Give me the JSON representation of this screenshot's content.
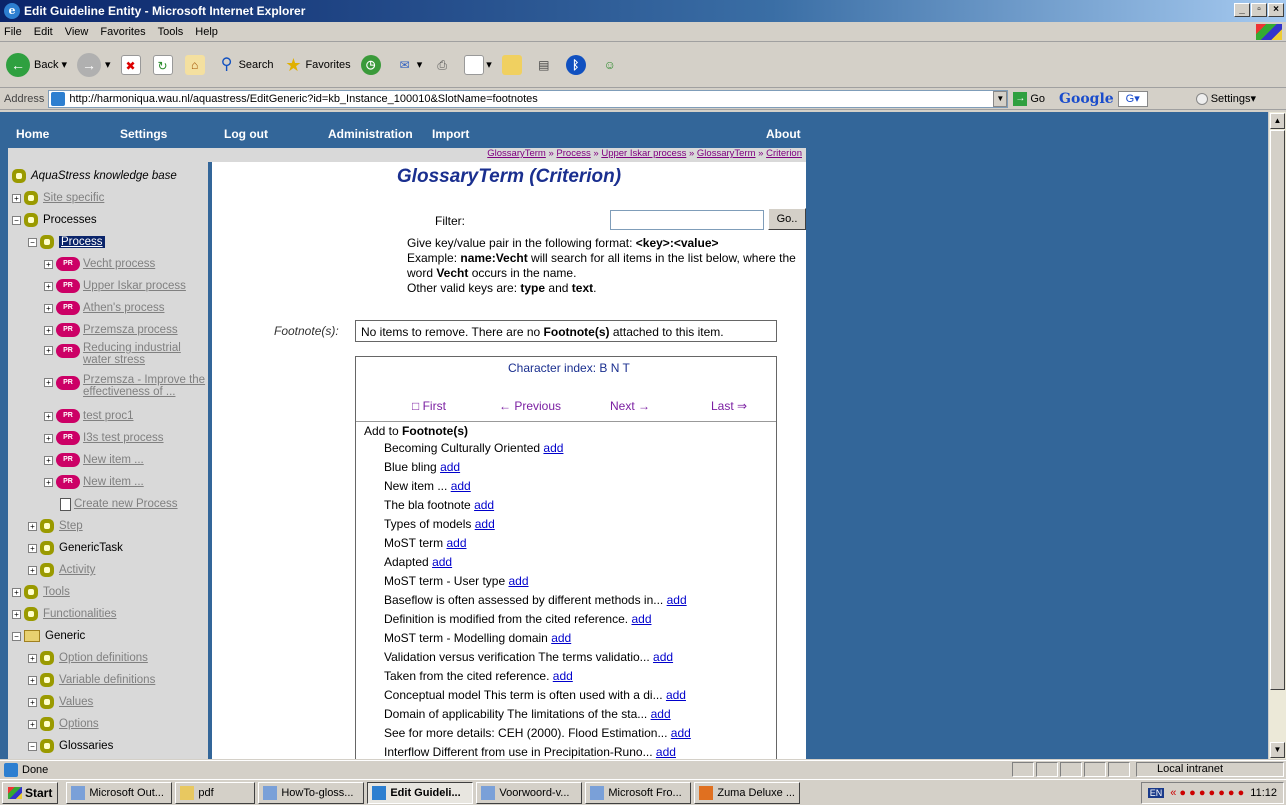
{
  "window": {
    "title": "Edit Guideline Entity - Microsoft Internet Explorer"
  },
  "menu": [
    "File",
    "Edit",
    "View",
    "Favorites",
    "Tools",
    "Help"
  ],
  "toolbar": {
    "back": "Back",
    "search": "Search",
    "favorites": "Favorites"
  },
  "address": {
    "label": "Address",
    "url": "http://harmoniqua.wau.nl/aquastress/EditGeneric?id=kb_Instance_100010&SlotName=footnotes",
    "go": "Go",
    "google": "Google",
    "settings": "Settings"
  },
  "nav": {
    "home": "Home",
    "settings": "Settings",
    "logout": "Log out",
    "administration": "Administration",
    "import": "Import",
    "about": "About"
  },
  "breadcrumb": [
    "GlossaryTerm",
    "Process",
    "Upper Iskar process",
    "GlossaryTerm",
    "Criterion"
  ],
  "breadcrumb_sep": "»",
  "tree": {
    "root": "AquaStress knowledge base",
    "site_specific": "Site specific",
    "processes": "Processes",
    "process": "Process",
    "proc_badge": "PR",
    "process_items": [
      "Vecht process",
      "Upper Iskar process",
      "Athen's process",
      "Przemsza process",
      "Reducing industrial water stress",
      "Przemsza - Improve the effectiveness of ...",
      "test proc1",
      "I3s test process",
      "New item ...",
      "New item ..."
    ],
    "create_new": "Create new Process",
    "step": "Step",
    "generic_task": "GenericTask",
    "activity": "Activity",
    "tools": "Tools",
    "functionalities": "Functionalities",
    "generic": "Generic",
    "option_definitions": "Option definitions",
    "variable_definitions": "Variable definitions",
    "values": "Values",
    "options": "Options",
    "glossaries": "Glossaries"
  },
  "page": {
    "title": "GlossaryTerm (Criterion)",
    "filter_label": "Filter:",
    "go": "Go..",
    "help1a": "Give key/value pair in the following format: ",
    "help1b": "<key>:<value>",
    "help2a": "Example: ",
    "help2b": "name:Vecht",
    "help2c": " will search for all items in the list below, where the word ",
    "help2d": "Vecht",
    "help2e": " occurs in the name.",
    "help3a": "Other valid keys are: ",
    "help3b": "type",
    "help3c": " and ",
    "help3d": "text",
    "help3e": ".",
    "footnote_label": "Footnote(s):",
    "no_items_a": "No items to remove. There are no ",
    "no_items_b": "Footnote(s)",
    "no_items_c": " attached to this item.",
    "char_index": "Character index:  B  N  T",
    "pager": {
      "first": "□ First",
      "previous": "← Previous",
      "next": "Next →",
      "last": "Last ⇒"
    },
    "add_to_a": "Add to ",
    "add_to_b": "Footnote(s)",
    "add_label": "add",
    "items": [
      "Becoming Culturally Oriented",
      "Blue bling",
      "New item ...",
      "The bla footnote",
      "Types of models",
      "MoST term",
      "Adapted",
      "MoST term - User type",
      "Baseflow is often assessed by different methods in...",
      "Definition is modified from the cited reference.",
      "MoST term - Modelling domain",
      "Validation versus verification The terms validatio...",
      "Taken from the cited reference.",
      "Conceptual model This term is often used with a di...",
      "Domain of applicability The limitations of the sta...",
      "See for more details: CEH (2000). Flood Estimation...",
      "Interflow Different from use in Precipitation-Runo..."
    ]
  },
  "status": {
    "text": "Done",
    "zone": "Local intranet"
  },
  "taskbar": {
    "start": "Start",
    "tasks": [
      "Microsoft Out...",
      "pdf",
      "HowTo-gloss...",
      "Edit Guideli...",
      "Voorwoord-v...",
      "Microsoft Fro...",
      "Zuma Deluxe ..."
    ],
    "active_index": 3,
    "time": "11:12",
    "lang": "EN"
  }
}
